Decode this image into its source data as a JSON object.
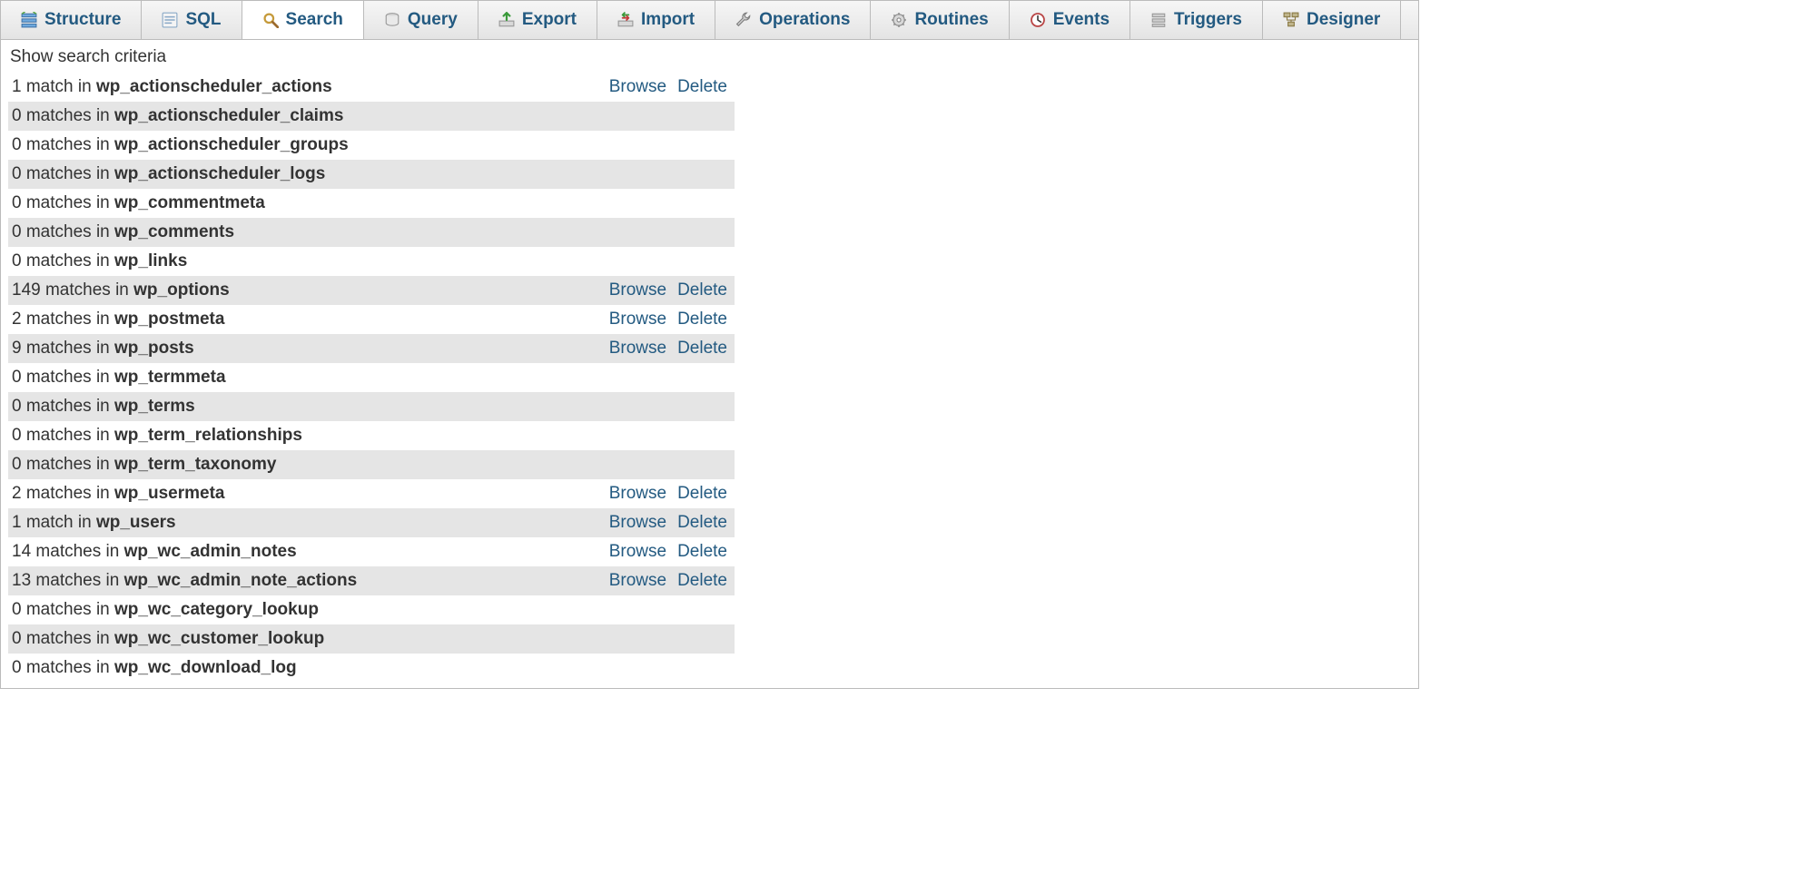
{
  "labels": {
    "browse": "Browse",
    "delete": "Delete",
    "criteria": "Show search criteria"
  },
  "tabs": [
    {
      "id": "structure",
      "label": "Structure",
      "icon": "structure-icon",
      "active": false
    },
    {
      "id": "sql",
      "label": "SQL",
      "icon": "sql-icon",
      "active": false
    },
    {
      "id": "search",
      "label": "Search",
      "icon": "search-icon",
      "active": true
    },
    {
      "id": "query",
      "label": "Query",
      "icon": "query-icon",
      "active": false
    },
    {
      "id": "export",
      "label": "Export",
      "icon": "export-icon",
      "active": false
    },
    {
      "id": "import",
      "label": "Import",
      "icon": "import-icon",
      "active": false
    },
    {
      "id": "operations",
      "label": "Operations",
      "icon": "wrench-icon",
      "active": false
    },
    {
      "id": "routines",
      "label": "Routines",
      "icon": "routines-icon",
      "active": false
    },
    {
      "id": "events",
      "label": "Events",
      "icon": "clock-icon",
      "active": false
    },
    {
      "id": "triggers",
      "label": "Triggers",
      "icon": "trigger-icon",
      "active": false
    },
    {
      "id": "designer",
      "label": "Designer",
      "icon": "designer-icon",
      "active": false
    }
  ],
  "results": [
    {
      "count": 1,
      "noun": "match",
      "table": "wp_actionscheduler_actions",
      "browse": true,
      "delete": true
    },
    {
      "count": 0,
      "noun": "matches",
      "table": "wp_actionscheduler_claims",
      "browse": false,
      "delete": false
    },
    {
      "count": 0,
      "noun": "matches",
      "table": "wp_actionscheduler_groups",
      "browse": false,
      "delete": false
    },
    {
      "count": 0,
      "noun": "matches",
      "table": "wp_actionscheduler_logs",
      "browse": false,
      "delete": false
    },
    {
      "count": 0,
      "noun": "matches",
      "table": "wp_commentmeta",
      "browse": false,
      "delete": false
    },
    {
      "count": 0,
      "noun": "matches",
      "table": "wp_comments",
      "browse": false,
      "delete": false
    },
    {
      "count": 0,
      "noun": "matches",
      "table": "wp_links",
      "browse": false,
      "delete": false
    },
    {
      "count": 149,
      "noun": "matches",
      "table": "wp_options",
      "browse": true,
      "delete": true
    },
    {
      "count": 2,
      "noun": "matches",
      "table": "wp_postmeta",
      "browse": true,
      "delete": true
    },
    {
      "count": 9,
      "noun": "matches",
      "table": "wp_posts",
      "browse": true,
      "delete": true
    },
    {
      "count": 0,
      "noun": "matches",
      "table": "wp_termmeta",
      "browse": false,
      "delete": false
    },
    {
      "count": 0,
      "noun": "matches",
      "table": "wp_terms",
      "browse": false,
      "delete": false
    },
    {
      "count": 0,
      "noun": "matches",
      "table": "wp_term_relationships",
      "browse": false,
      "delete": false
    },
    {
      "count": 0,
      "noun": "matches",
      "table": "wp_term_taxonomy",
      "browse": false,
      "delete": false
    },
    {
      "count": 2,
      "noun": "matches",
      "table": "wp_usermeta",
      "browse": true,
      "delete": true
    },
    {
      "count": 1,
      "noun": "match",
      "table": "wp_users",
      "browse": true,
      "delete": true
    },
    {
      "count": 14,
      "noun": "matches",
      "table": "wp_wc_admin_notes",
      "browse": true,
      "delete": true
    },
    {
      "count": 13,
      "noun": "matches",
      "table": "wp_wc_admin_note_actions",
      "browse": true,
      "delete": true
    },
    {
      "count": 0,
      "noun": "matches",
      "table": "wp_wc_category_lookup",
      "browse": false,
      "delete": false
    },
    {
      "count": 0,
      "noun": "matches",
      "table": "wp_wc_customer_lookup",
      "browse": false,
      "delete": false
    },
    {
      "count": 0,
      "noun": "matches",
      "table": "wp_wc_download_log",
      "browse": false,
      "delete": false
    }
  ]
}
